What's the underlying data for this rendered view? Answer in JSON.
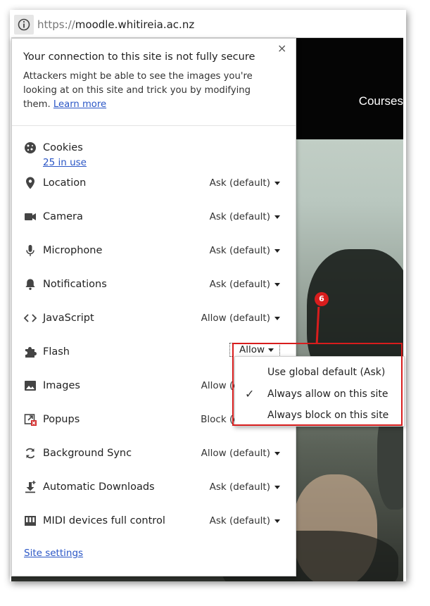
{
  "url": {
    "scheme": "https://",
    "host": "moodle.whitireia.ac.nz"
  },
  "background": {
    "nav_text": "Courses"
  },
  "popup": {
    "title": "Your connection to this site is not fully secure",
    "description": "Attackers might be able to see the images you're looking at on this site and trick you by modifying them.",
    "learn_more": "Learn more",
    "close_glyph": "×"
  },
  "permissions": [
    {
      "icon": "cookie-icon",
      "label": "Cookies",
      "sublabel": "25 in use"
    },
    {
      "icon": "location-pin-icon",
      "label": "Location",
      "value": "Ask (default)"
    },
    {
      "icon": "camera-icon",
      "label": "Camera",
      "value": "Ask (default)"
    },
    {
      "icon": "microphone-icon",
      "label": "Microphone",
      "value": "Ask (default)"
    },
    {
      "icon": "bell-icon",
      "label": "Notifications",
      "value": "Ask (default)"
    },
    {
      "icon": "code-icon",
      "label": "JavaScript",
      "value": "Allow (default)"
    },
    {
      "icon": "puzzle-icon",
      "label": "Flash",
      "value": "Allow"
    },
    {
      "icon": "image-icon",
      "label": "Images",
      "value": "Allow (default)"
    },
    {
      "icon": "popup-blocked-icon",
      "label": "Popups",
      "value": "Block (default)"
    },
    {
      "icon": "sync-icon",
      "label": "Background Sync",
      "value": "Allow (default)"
    },
    {
      "icon": "download-icon",
      "label": "Automatic Downloads",
      "value": "Ask (default)"
    },
    {
      "icon": "midi-icon",
      "label": "MIDI devices full control",
      "value": "Ask (default)"
    }
  ],
  "site_settings": "Site settings",
  "flash_dropdown": {
    "options": [
      "Use global default (Ask)",
      "Always allow on this site",
      "Always block on this site"
    ],
    "selected_index": 1,
    "check_glyph": "✓"
  },
  "callout": {
    "number": "6",
    "color": "#d81d1d"
  }
}
